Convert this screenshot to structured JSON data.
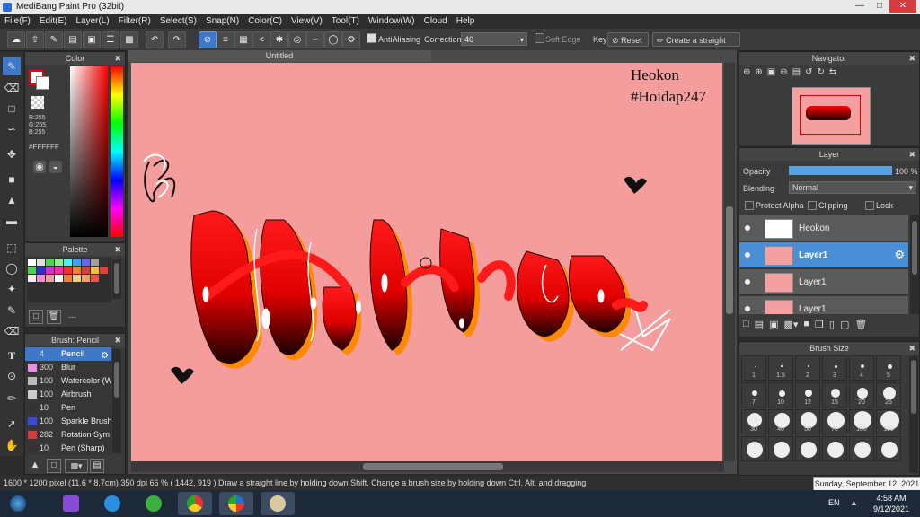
{
  "window": {
    "title": "MediBang Paint Pro (32bit)",
    "controls": [
      "—",
      "□",
      "✕"
    ]
  },
  "menu": [
    "File(F)",
    "Edit(E)",
    "Layer(L)",
    "Filter(R)",
    "Select(S)",
    "Snap(N)",
    "Color(C)",
    "View(V)",
    "Tool(T)",
    "Window(W)",
    "Cloud",
    "Help"
  ],
  "toolbar": {
    "antialiasing": "AntiAliasing",
    "correction_label": "Correction",
    "correction_value": "40",
    "soft_edge": "Soft Edge",
    "key_label": "Key",
    "reset": "Reset",
    "straight_line": "Create a straight line"
  },
  "color_panel": {
    "title": "Color",
    "r": "R:255",
    "g": "G:255",
    "b": "B:255",
    "hex": "#FFFFFF"
  },
  "palette_panel": {
    "title": "Palette",
    "footer": "---"
  },
  "brush_panel": {
    "title": "Brush: Pencil",
    "items": [
      {
        "size": "4",
        "name": "Pencil",
        "color": "#3e78c9"
      },
      {
        "size": "300",
        "name": "Blur",
        "color": "#e98ee6"
      },
      {
        "size": "100",
        "name": "Watercolor (W",
        "color": "#bbbbbb"
      },
      {
        "size": "100",
        "name": "Airbrush",
        "color": "#cccccc"
      },
      {
        "size": "10",
        "name": "Pen",
        "color": "#333333"
      },
      {
        "size": "100",
        "name": "Sparkle Brush",
        "color": "#3b4bd6"
      },
      {
        "size": "282",
        "name": "Rotation Sym",
        "color": "#d43b3b"
      },
      {
        "size": "10",
        "name": "Pen (Sharp)",
        "color": "#333333"
      }
    ]
  },
  "canvas": {
    "tab_title": "Untitled",
    "watermark_line1": "Heokon",
    "watermark_line2": "#Hoidap247",
    "artwork_text": "Nhi Hoa"
  },
  "navigator": {
    "title": "Navigator"
  },
  "layer_panel": {
    "title": "Layer",
    "opacity_label": "Opacity",
    "opacity_value": "100 %",
    "opacity_fraction": 1.0,
    "blending_label": "Blending",
    "blending_value": "Normal",
    "protect_alpha": "Protect Alpha",
    "clipping": "Clipping",
    "lock": "Lock",
    "layers": [
      {
        "name": "Heokon",
        "selected": false
      },
      {
        "name": "Layer1",
        "selected": true
      },
      {
        "name": "Layer1",
        "selected": false
      },
      {
        "name": "Layer1",
        "selected": false
      }
    ]
  },
  "brush_size_panel": {
    "title": "Brush Size",
    "sizes": [
      "1",
      "1.5",
      "2",
      "3",
      "4",
      "5",
      "7",
      "10",
      "12",
      "15",
      "20",
      "25",
      "30",
      "40",
      "50",
      "70",
      "100",
      "150",
      "",
      "",
      "",
      "",
      "",
      ""
    ]
  },
  "status": {
    "text": "1600 * 1200 pixel   (11.6 * 8.7cm)   350 dpi   66 %   ( 1442, 919 )   Draw a straight line by holding down Shift, Change a brush size by holding down Ctrl, Alt, and dragging",
    "tooltip": "Sunday, September 12, 2021"
  },
  "taskbar": {
    "lang": "EN",
    "time": "4:58 AM",
    "date": "9/12/2021"
  }
}
